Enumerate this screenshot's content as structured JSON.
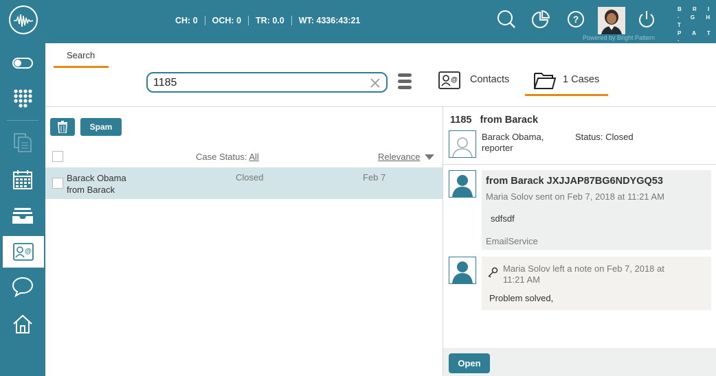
{
  "topbar": {
    "logo_icon": "waveform-logo-icon",
    "stats": [
      {
        "label": "CH: 0"
      },
      {
        "label": "OCH: 0"
      },
      {
        "label": "TR: 0.0"
      },
      {
        "label": "WT: 4336:43:21"
      }
    ],
    "icons": [
      "search-icon",
      "pie-chart-icon",
      "help-icon",
      "power-icon"
    ],
    "powered_by": "Powered by Bright Pattern",
    "brand_lines": [
      "B R I",
      "· G H T",
      "P A T ·",
      "T E R N"
    ]
  },
  "nav": {
    "items": [
      "toggle-icon",
      "dialpad-icon",
      "documents-icon",
      "calendar-icon",
      "inbox-icon",
      "contacts-icon",
      "chat-icon",
      "home-icon"
    ],
    "active": "contacts-icon"
  },
  "search": {
    "tab_label": "Search",
    "query": "1185",
    "tabs": [
      {
        "label": "Contacts",
        "icon": "contact-card-icon"
      },
      {
        "label": "1 Cases",
        "icon": "folder-icon"
      }
    ]
  },
  "list": {
    "spam_label": "Spam",
    "case_status_label": "Case Status:",
    "case_status_value": "All",
    "sort_label": "Relevance",
    "rows": [
      {
        "name": "Barack Obama",
        "subject": "from Barack",
        "status": "Closed",
        "date": "Feb 7"
      }
    ]
  },
  "detail": {
    "case_number": "1185",
    "case_subject": "from Barack",
    "contact_name": "Barack Obama,",
    "contact_role": "reporter",
    "status": "Status: Closed",
    "messages": [
      {
        "subject": "from Barack JXJJAP87BG6NDYGQ53",
        "meta": "Maria Solov sent on Feb 7, 2018 at 11:21 AM",
        "body": "sdfsdf",
        "service": "EmailService"
      }
    ],
    "note": {
      "meta_line1": "Maria Solov left a note on Feb 7, 2018 at",
      "meta_line2": "11:21 AM",
      "body": "Problem solved,"
    },
    "open_label": "Open"
  },
  "colors": {
    "brand": "#2f7e95",
    "accent": "#e58a16",
    "row_selected": "#d2e4e8"
  }
}
